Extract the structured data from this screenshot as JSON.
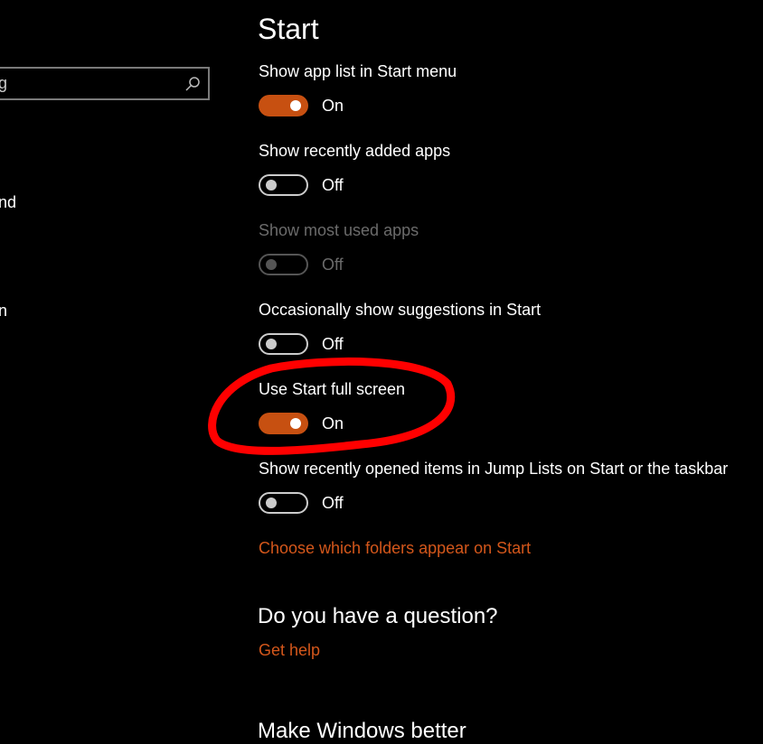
{
  "sidebar": {
    "search_value": "g",
    "items": [
      "nd",
      "n"
    ]
  },
  "page": {
    "title": "Start"
  },
  "settings": [
    {
      "label": "Show app list in Start menu",
      "state": "On",
      "on": true,
      "disabled": false
    },
    {
      "label": "Show recently added apps",
      "state": "Off",
      "on": false,
      "disabled": false
    },
    {
      "label": "Show most used apps",
      "state": "Off",
      "on": false,
      "disabled": true
    },
    {
      "label": "Occasionally show suggestions in Start",
      "state": "Off",
      "on": false,
      "disabled": false
    },
    {
      "label": "Use Start full screen",
      "state": "On",
      "on": true,
      "disabled": false
    },
    {
      "label": "Show recently opened items in Jump Lists on Start or the taskbar",
      "state": "Off",
      "on": false,
      "disabled": false
    }
  ],
  "folders_link": "Choose which folders appear on Start",
  "question": {
    "heading": "Do you have a question?",
    "link": "Get help"
  },
  "feedback": {
    "heading": "Make Windows better"
  },
  "colors": {
    "accent": "#c75011",
    "annotation": "#ff0000"
  }
}
